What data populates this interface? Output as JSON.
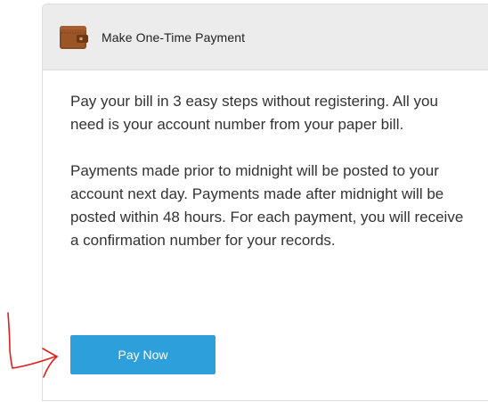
{
  "header": {
    "title": "Make One-Time Payment",
    "icon": "wallet-icon"
  },
  "body": {
    "paragraph_1": "Pay your bill in 3 easy steps without registering. All you need is your account number from your paper bill.",
    "paragraph_2": "Payments made prior to midnight will be posted to your account next day. Payments made after midnight will be posted within 48 hours. For each payment, you will receive a confirmation number for your records."
  },
  "actions": {
    "pay_now_label": "Pay Now"
  },
  "colors": {
    "button_bg": "#2d9fdb",
    "header_bg": "#ececec",
    "annotation": "#e0201c"
  }
}
